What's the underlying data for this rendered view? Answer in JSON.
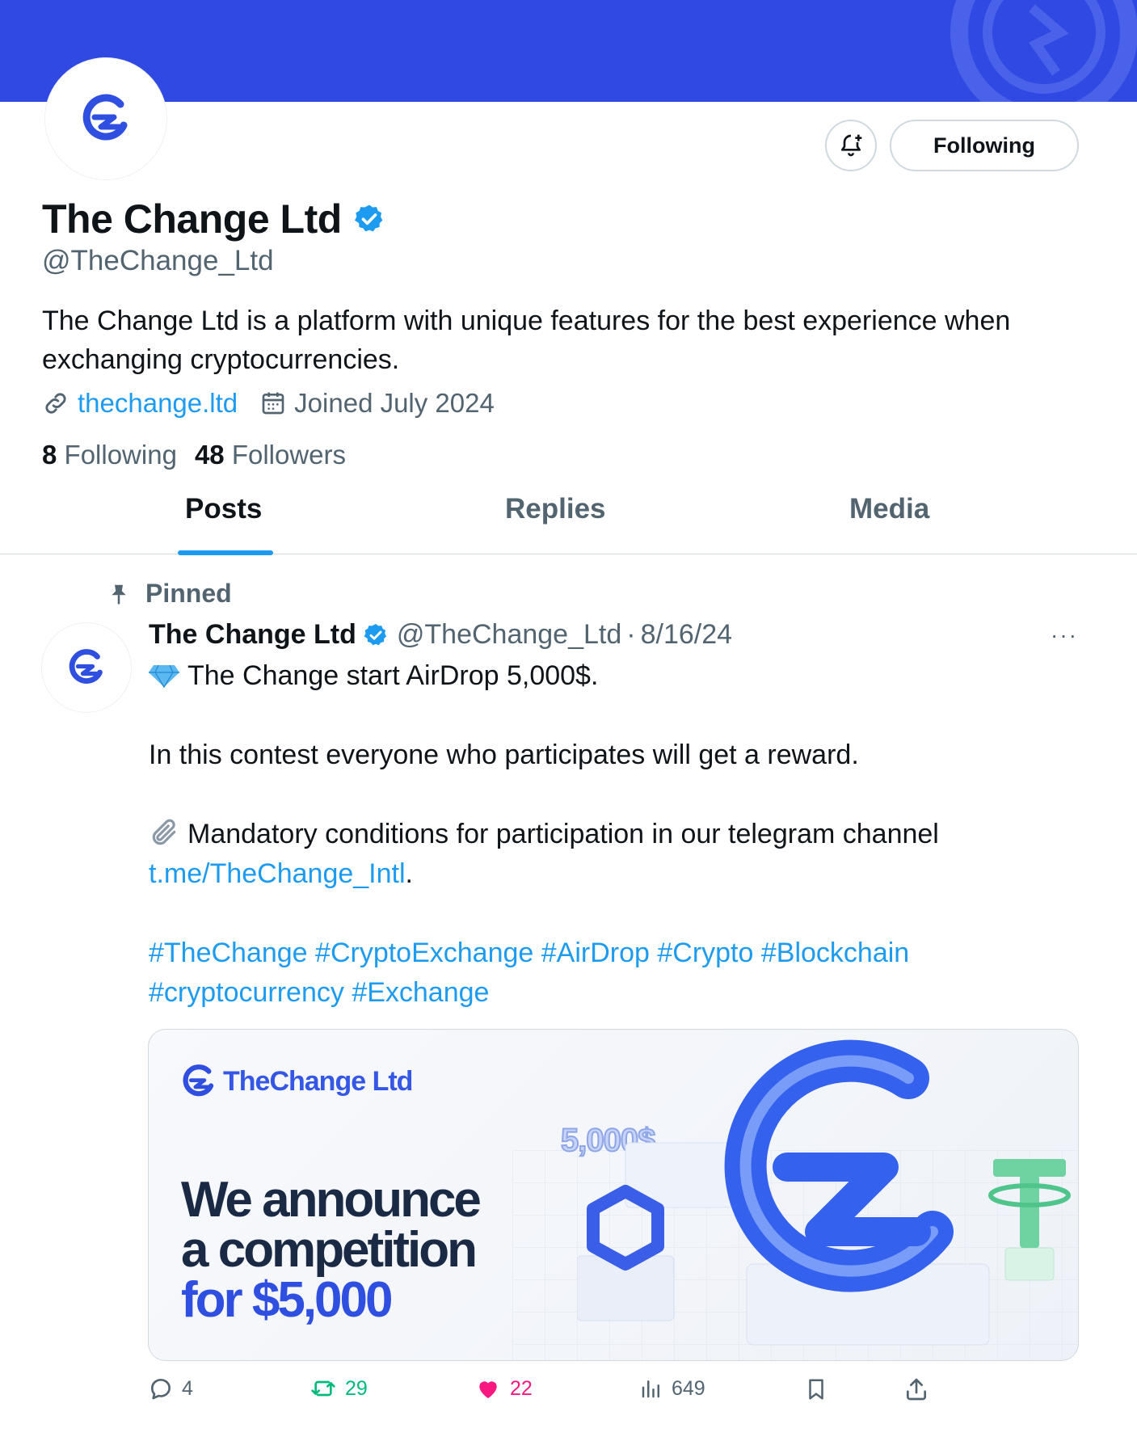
{
  "profile": {
    "name": "The Change Ltd",
    "handle": "@TheChange_Ltd",
    "bio": "The Change Ltd is a platform with unique features for the best experience when exchanging cryptocurrencies.",
    "website": "thechange.ltd",
    "joined": "Joined July 2024",
    "following_count": "8",
    "following_label": "Following",
    "followers_count": "48",
    "followers_label": "Followers",
    "follow_button": "Following"
  },
  "tabs": [
    {
      "label": "Posts",
      "active": true
    },
    {
      "label": "Replies",
      "active": false
    },
    {
      "label": "Media",
      "active": false
    }
  ],
  "post": {
    "pinned_label": "Pinned",
    "author": "The Change Ltd",
    "handle": "@TheChange_Ltd",
    "separator": "·",
    "date": "8/16/24",
    "more": "···",
    "line1": "The Change start AirDrop 5,000$.",
    "line2": "In this contest everyone who participates will get a reward.",
    "line3": "Mandatory conditions for participation in our telegram channel",
    "telegram_link": "t.me/TheChange_Intl",
    "period": ".",
    "hashtags_line1": "#TheChange #CryptoExchange #AirDrop #Crypto #Blockchain",
    "hashtags_line2": "#cryptocurrency #Exchange",
    "card": {
      "brand": "TheChange Ltd",
      "headline1": "We announce",
      "headline2": "a competition",
      "headline3": "for $5,000",
      "prize": "5,000$"
    },
    "stats": {
      "replies": "4",
      "reposts": "29",
      "likes": "22",
      "views": "649"
    }
  },
  "colors": {
    "banner": "#2f49e2",
    "link": "#1d9bf0",
    "verified": "#1d9bf0",
    "repost": "#00ba7c",
    "like": "#f91880"
  }
}
